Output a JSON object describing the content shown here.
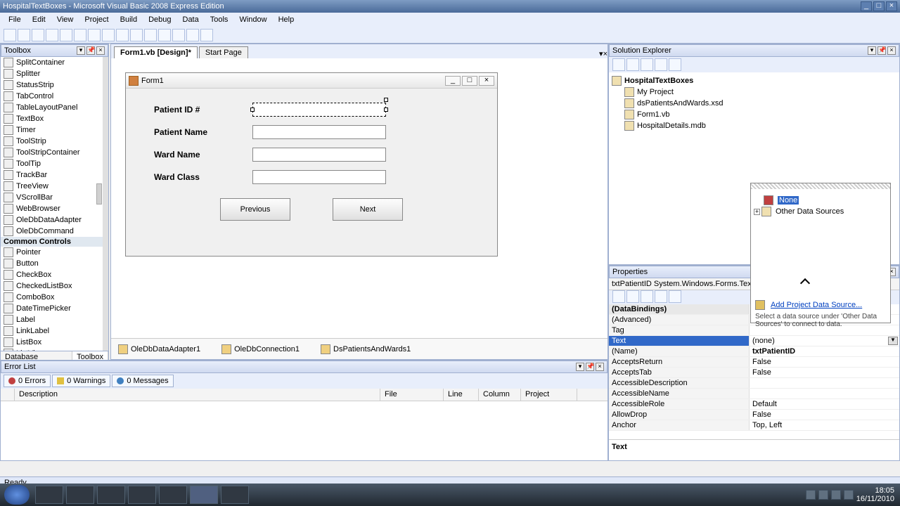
{
  "app": {
    "title": "HospitalTextBoxes - Microsoft Visual Basic 2008 Express Edition"
  },
  "menu": [
    "File",
    "Edit",
    "View",
    "Project",
    "Build",
    "Debug",
    "Data",
    "Tools",
    "Window",
    "Help"
  ],
  "toolbox": {
    "title": "Toolbox",
    "items": [
      "SplitContainer",
      "Splitter",
      "StatusStrip",
      "TabControl",
      "TableLayoutPanel",
      "TextBox",
      "Timer",
      "ToolStrip",
      "ToolStripContainer",
      "ToolTip",
      "TrackBar",
      "TreeView",
      "VScrollBar",
      "WebBrowser",
      "OleDbDataAdapter",
      "OleDbCommand"
    ],
    "group": "Common Controls",
    "items2": [
      "Pointer",
      "Button",
      "CheckBox",
      "CheckedListBox",
      "ComboBox",
      "DateTimePicker",
      "Label",
      "LinkLabel",
      "ListBox",
      "ListView"
    ],
    "tabs": {
      "dbexplorer": "Database Explorer",
      "toolbox": "Toolbox"
    }
  },
  "designer": {
    "tabs": {
      "active": "Form1.vb [Design]*",
      "other": "Start Page"
    },
    "form": {
      "title": "Form1",
      "labels": {
        "pid": "Patient ID #",
        "pname": "Patient Name",
        "ward": "Ward Name",
        "wclass": "Ward Class"
      },
      "buttons": {
        "prev": "Previous",
        "next": "Next"
      }
    },
    "components": {
      "adapter": "OleDbDataAdapter1",
      "conn": "OleDbConnection1",
      "ds": "DsPatientsAndWards1"
    }
  },
  "solution": {
    "title": "Solution Explorer",
    "root": "HospitalTextBoxes",
    "items": [
      "My Project",
      "dsPatientsAndWards.xsd",
      "Form1.vb",
      "HospitalDetails.mdb"
    ]
  },
  "dbpopup": {
    "none": "None",
    "other": "Other Data Sources",
    "addlink": "Add Project Data Source...",
    "hint": "Select a data source under 'Other Data Sources' to connect to data."
  },
  "properties": {
    "title": "Properties",
    "object": "txtPatientID  System.Windows.Forms.TextBox",
    "rows": [
      {
        "name": "(DataBindings)",
        "val": "",
        "group": true
      },
      {
        "name": "  (Advanced)",
        "val": ""
      },
      {
        "name": "  Tag",
        "val": ""
      },
      {
        "name": "  Text",
        "val": "(none)",
        "selected": true,
        "dd": true
      },
      {
        "name": "(Name)",
        "val": "txtPatientID",
        "bold": true
      },
      {
        "name": "AcceptsReturn",
        "val": "False"
      },
      {
        "name": "AcceptsTab",
        "val": "False"
      },
      {
        "name": "AccessibleDescription",
        "val": ""
      },
      {
        "name": "AccessibleName",
        "val": ""
      },
      {
        "name": "AccessibleRole",
        "val": "Default"
      },
      {
        "name": "AllowDrop",
        "val": "False"
      },
      {
        "name": "Anchor",
        "val": "Top, Left"
      }
    ],
    "desc": "Text"
  },
  "errorlist": {
    "title": "Error List",
    "tabs": {
      "errors": "0 Errors",
      "warnings": "0 Warnings",
      "messages": "0 Messages"
    },
    "cols": [
      "",
      "Description",
      "File",
      "Line",
      "Column",
      "Project"
    ]
  },
  "status": "Ready",
  "tray": {
    "time": "18:05",
    "date": "16/11/2010"
  }
}
